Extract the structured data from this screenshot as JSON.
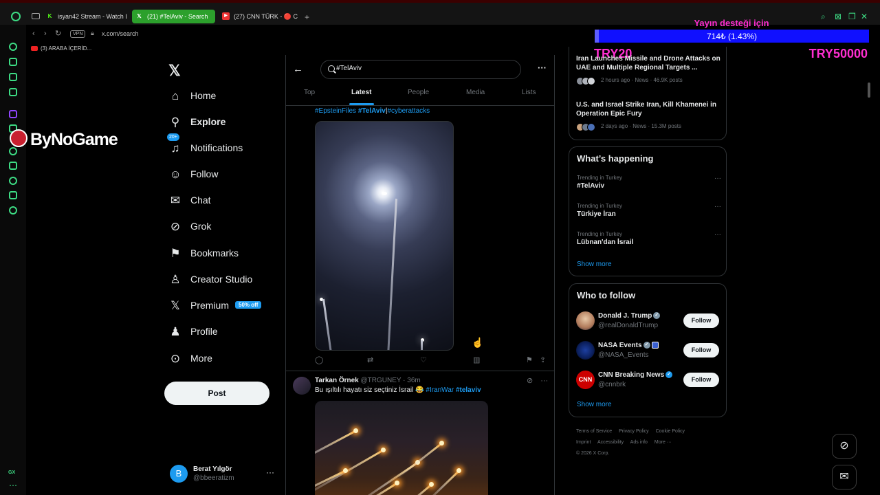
{
  "browser": {
    "tabs": [
      {
        "label": "isyan42 Stream - Watch Li",
        "icon": "kick-icon"
      },
      {
        "label": "(21) #TelAviv - Search",
        "icon": "x-icon",
        "active": true
      },
      {
        "label": "(27) CNN TÜRK - 🔴 C",
        "icon": "youtube-icon"
      }
    ],
    "url": "x.com/search",
    "vpn_label": "VPN",
    "bookmark": "(3) ARABA İÇERİD...",
    "sidebar_label": "GX"
  },
  "overlay": {
    "watermark": "ByNoGame",
    "donation_title": "Yayın desteği için",
    "donation_amount": "714₺ (1.43%)",
    "donation_progress": 0.0143,
    "donation_min": "TRY20",
    "donation_max": "TRY50000"
  },
  "nav": {
    "items": [
      {
        "label": "Home",
        "icon": "home-icon"
      },
      {
        "label": "Explore",
        "icon": "search-icon",
        "active": true
      },
      {
        "label": "Notifications",
        "icon": "bell-icon",
        "badge": "20+"
      },
      {
        "label": "Follow",
        "icon": "follow-icon"
      },
      {
        "label": "Chat",
        "icon": "mail-icon"
      },
      {
        "label": "Grok",
        "icon": "grok-icon"
      },
      {
        "label": "Bookmarks",
        "icon": "bookmark-icon"
      },
      {
        "label": "Creator Studio",
        "icon": "creator-icon"
      },
      {
        "label": "Premium",
        "icon": "x-icon",
        "badge": "50% off"
      },
      {
        "label": "Profile",
        "icon": "profile-icon"
      },
      {
        "label": "More",
        "icon": "more-icon"
      }
    ],
    "post_label": "Post",
    "account": {
      "initial": "B",
      "name": "Berat Yılgör",
      "handle": "@bbeeratizm"
    }
  },
  "search": {
    "query": "#TelAviv",
    "tabs": [
      "Top",
      "Latest",
      "People",
      "Media",
      "Lists"
    ],
    "active_tab": "Latest"
  },
  "tweets": [
    {
      "tags": [
        "#EpsteinFiles",
        "#TelAviv",
        "#cyberattacks"
      ]
    },
    {
      "name": "Tarkan Örnek",
      "handle": "@TRGUNEY",
      "time": "36m",
      "text": "Bu ışıltılı hayatı siz seçtiniz İsrail 😂",
      "hashtags": [
        "#IranWar",
        "#telaviv"
      ]
    }
  ],
  "news": [
    {
      "title": "Iran Launches Missile and Drone Attacks on UAE and Multiple Regional Targets ...",
      "meta": "2 hours ago · News · 46.9K posts"
    },
    {
      "title": "U.S. and Israel Strike Iran, Kill Khamenei in Operation Epic Fury",
      "meta": "2 days ago · News · 15.3M posts"
    }
  ],
  "happening": {
    "title": "What’s happening",
    "trends": [
      {
        "context": "Trending in Turkey",
        "name": "#TelAviv"
      },
      {
        "context": "Trending in Turkey",
        "name": "Türkiye İran"
      },
      {
        "context": "Trending in Turkey",
        "name": "Lübnan'dan İsrail"
      }
    ],
    "show_more": "Show more"
  },
  "who_to_follow": {
    "title": "Who to follow",
    "accounts": [
      {
        "name": "Donald J. Trump",
        "handle": "@realDonaldTrump",
        "badge": "gray"
      },
      {
        "name": "NASA Events",
        "handle": "@NASA_Events",
        "badge": "gray"
      },
      {
        "name": "CNN Breaking News",
        "handle": "@cnnbrk",
        "badge": "blue",
        "avatar_text": "CNN"
      }
    ],
    "follow_label": "Follow",
    "show_more": "Show more"
  },
  "footer": {
    "links": [
      "Terms of Service",
      "Privacy Policy",
      "Cookie Policy",
      "Imprint",
      "Accessibility",
      "Ads info",
      "More ···"
    ],
    "copyright": "© 2026 X Corp."
  },
  "colors": {
    "accent": "#1d9bf0",
    "opera_green": "#3ddc84",
    "donation_pink": "#ff2ed1"
  }
}
